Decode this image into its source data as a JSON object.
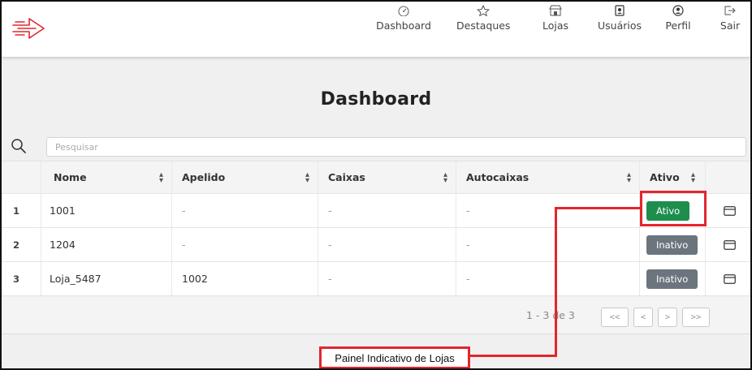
{
  "nav": {
    "items": [
      {
        "label": "Dashboard",
        "icon": "dashboard-gauge-icon"
      },
      {
        "label": "Destaques",
        "icon": "star-icon"
      },
      {
        "label": "Lojas",
        "icon": "store-icon"
      },
      {
        "label": "Usuários",
        "icon": "user-badge-icon"
      },
      {
        "label": "Perfil",
        "icon": "profile-icon"
      },
      {
        "label": "Sair",
        "icon": "logout-icon"
      }
    ]
  },
  "page": {
    "title": "Dashboard"
  },
  "search": {
    "placeholder": "Pesquisar",
    "value": ""
  },
  "table": {
    "columns": [
      "Nome",
      "Apelido",
      "Caixas",
      "Autocaixas",
      "Ativo"
    ],
    "rows": [
      {
        "index": "1",
        "nome": "1001",
        "apelido": "-",
        "caixas": "-",
        "autocaixas": "-",
        "status": "Ativo"
      },
      {
        "index": "2",
        "nome": "1204",
        "apelido": "-",
        "caixas": "-",
        "autocaixas": "-",
        "status": "Inativo"
      },
      {
        "index": "3",
        "nome": "Loja_5487",
        "apelido": "1002",
        "caixas": "-",
        "autocaixas": "-",
        "status": "Inativo"
      }
    ]
  },
  "pagination": {
    "summary": "1 - 3 de 3",
    "first": "<<",
    "prev": "<",
    "next": ">",
    "last": ">>"
  },
  "annotation": {
    "label": "Painel Indicativo de Lojas",
    "color": "#e3262d"
  },
  "colors": {
    "active": "#1e8e4e",
    "inactive": "#6c757d",
    "brand": "#e3262d"
  }
}
